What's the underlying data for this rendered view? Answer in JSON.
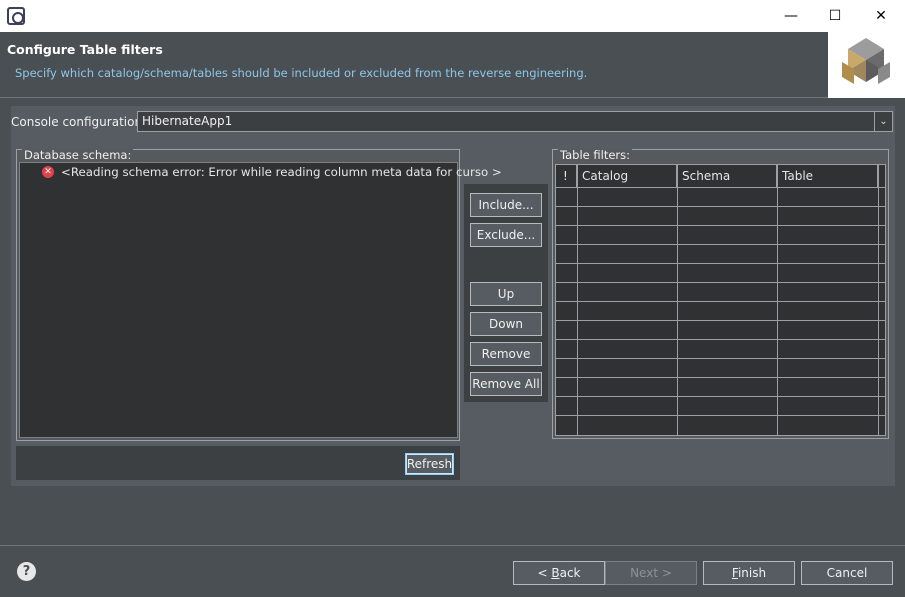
{
  "window": {
    "title": "",
    "controls": {
      "minimize": "—",
      "maximize": "☐",
      "close": "✕"
    }
  },
  "header": {
    "title": "Configure Table filters",
    "description": "Specify which catalog/schema/tables should be included or excluded from the reverse engineering."
  },
  "console": {
    "label": "Console configuration:",
    "value": "HibernateApp1",
    "arrow": "⌄"
  },
  "schema": {
    "legend": "Database schema:",
    "error_icon": "error-icon",
    "error_glyph": "✕",
    "error_text": "<Reading schema error: Error while reading column meta data for curso >",
    "refresh_label": "Refresh"
  },
  "actions": {
    "include": "Include...",
    "exclude": "Exclude...",
    "up": "Up",
    "down": "Down",
    "remove": "Remove",
    "remove_all": "Remove All"
  },
  "filters": {
    "legend": "Table filters:",
    "columns": [
      "!",
      "Catalog",
      "Schema",
      "Table"
    ]
  },
  "footer": {
    "help": "?",
    "back_pre": "< ",
    "back_key": "B",
    "back_rest": "ack",
    "next": "Next >",
    "finish_key": "F",
    "finish_rest": "inish",
    "cancel": "Cancel"
  }
}
